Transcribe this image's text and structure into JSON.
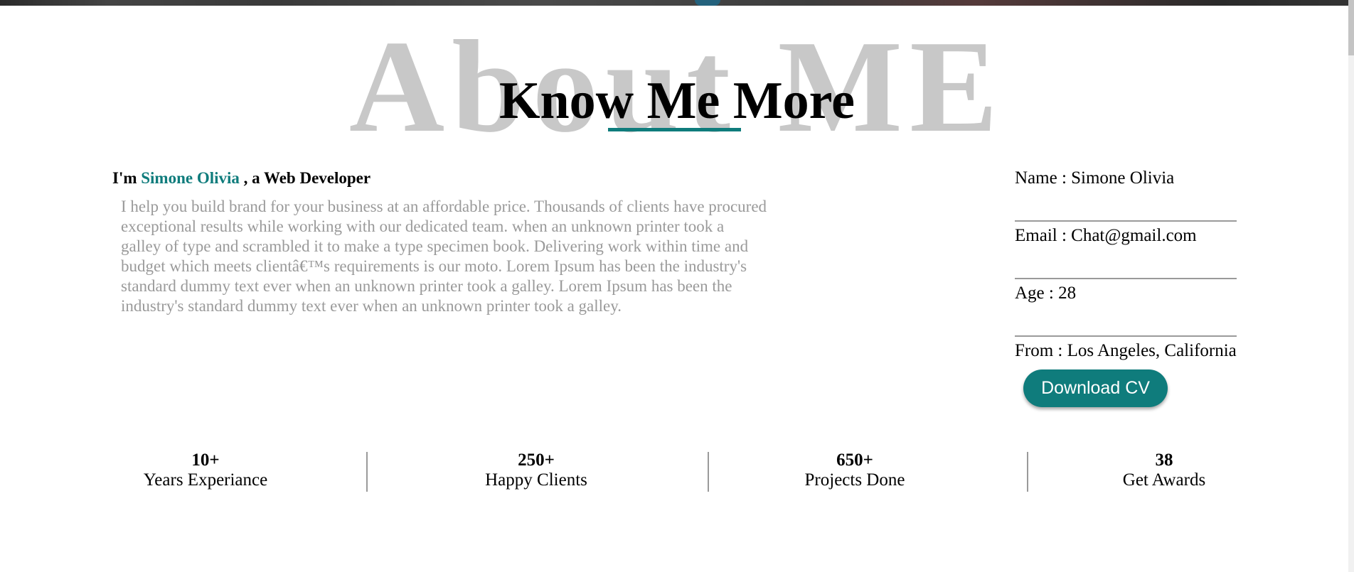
{
  "heading": {
    "watermark": "About ME",
    "title": "Know Me More"
  },
  "intro": {
    "prefix": "I'm ",
    "name": "Simone Olivia",
    "suffix": " , a Web Developer"
  },
  "bio": "I help you build brand for your business at an affordable price. Thousands of clients have procured exceptional results while working with our dedicated team. when an unknown printer took a galley of type and scrambled it to make a type specimen book. Delivering work within time and budget which meets clientâ€™s requirements is our moto. Lorem Ipsum has been the industry's standard dummy text ever when an unknown printer took a galley. Lorem Ipsum has been the industry's standard dummy text ever when an unknown printer took a galley.",
  "details": {
    "name": "Name : Simone Olivia",
    "email": "Email : Chat@gmail.com",
    "age": "Age : 28",
    "from": "From : Los Angeles, California"
  },
  "download_label": "Download CV",
  "stats": [
    {
      "value": "10+",
      "label": "Years Experiance"
    },
    {
      "value": "250+",
      "label": "Happy Clients"
    },
    {
      "value": "650+",
      "label": "Projects Done"
    },
    {
      "value": "38",
      "label": "Get Awards"
    }
  ],
  "colors": {
    "accent": "#0f7c7c",
    "muted_text": "#9a9a9a",
    "watermark": "#c8c8c8"
  }
}
